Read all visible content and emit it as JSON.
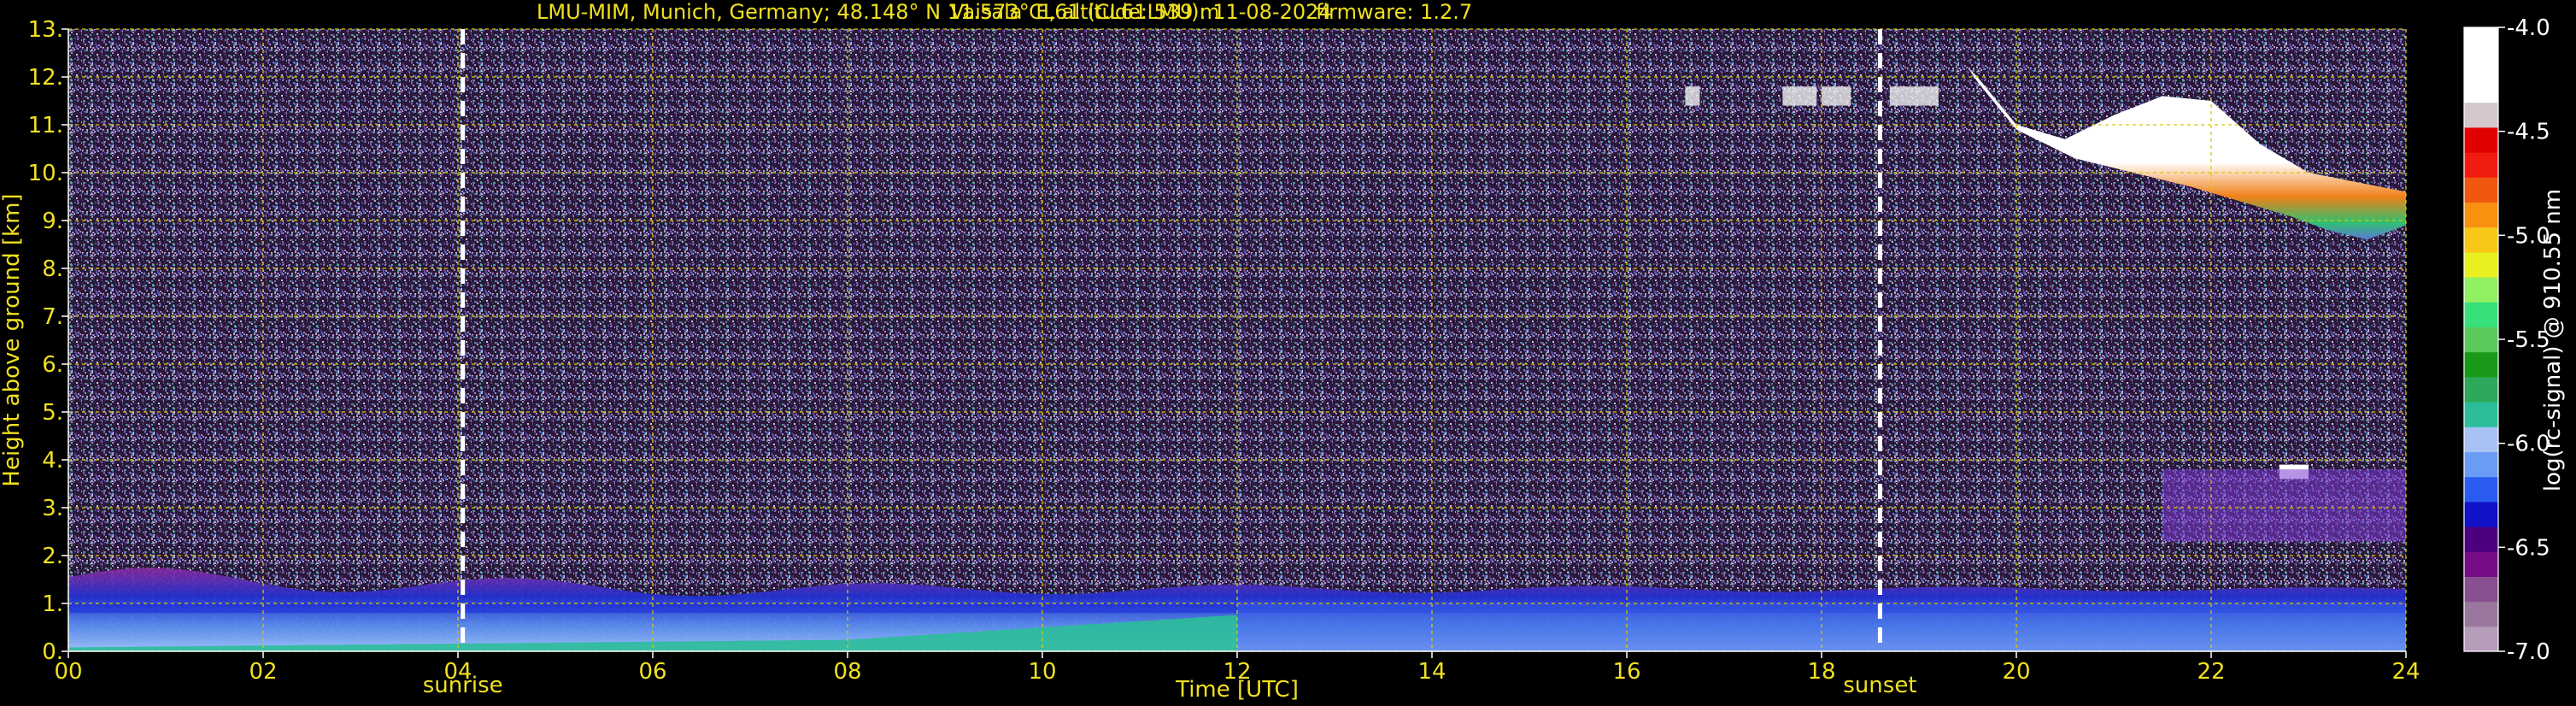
{
  "title_left": "LMU-MIM, Munich, Germany; 48.148° N 11.573° E, altitude: 539 m",
  "title_mid": "Vaisala CL61 (CL61LMU): 11-08-2024",
  "title_right": "firmware: 1.2.7",
  "colors": {
    "text": "#f0e020",
    "background": "#000000",
    "grid": "#d8c800",
    "marker": "#ffffff"
  },
  "chart_data": {
    "type": "heatmap",
    "xlabel": "Time [UTC]",
    "ylabel": "Height above ground [km]",
    "xlim": [
      0,
      24
    ],
    "ylim": [
      0,
      13
    ],
    "x_ticks": [
      {
        "v": 0,
        "label": "00"
      },
      {
        "v": 2,
        "label": "02"
      },
      {
        "v": 4,
        "label": "04"
      },
      {
        "v": 6,
        "label": "06"
      },
      {
        "v": 8,
        "label": "08"
      },
      {
        "v": 10,
        "label": "10"
      },
      {
        "v": 12,
        "label": "12"
      },
      {
        "v": 14,
        "label": "14"
      },
      {
        "v": 16,
        "label": "16"
      },
      {
        "v": 18,
        "label": "18"
      },
      {
        "v": 20,
        "label": "20"
      },
      {
        "v": 22,
        "label": "22"
      },
      {
        "v": 24,
        "label": "24"
      }
    ],
    "y_ticks": [
      {
        "v": 0,
        "label": "0."
      },
      {
        "v": 1,
        "label": "1."
      },
      {
        "v": 2,
        "label": "2."
      },
      {
        "v": 3,
        "label": "3."
      },
      {
        "v": 4,
        "label": "4."
      },
      {
        "v": 5,
        "label": "5."
      },
      {
        "v": 6,
        "label": "6."
      },
      {
        "v": 7,
        "label": "7."
      },
      {
        "v": 8,
        "label": "8."
      },
      {
        "v": 9,
        "label": "9."
      },
      {
        "v": 10,
        "label": "10."
      },
      {
        "v": 11,
        "label": "11."
      },
      {
        "v": 12,
        "label": "12."
      },
      {
        "v": 13,
        "label": "13."
      }
    ],
    "grid": true,
    "markers": [
      {
        "label": "sunrise",
        "time": 4.05
      },
      {
        "label": "sunset",
        "time": 18.6
      }
    ],
    "colorbar": {
      "label": "log(rc-signal) @ 910.55 nm",
      "min": -7.0,
      "max": -4.0,
      "ticks": [
        {
          "v": -4.0,
          "label": "-4.0"
        },
        {
          "v": -4.5,
          "label": "-4.5"
        },
        {
          "v": -5.0,
          "label": "-5.0"
        },
        {
          "v": -5.5,
          "label": "-5.5"
        },
        {
          "v": -6.0,
          "label": "-6.0"
        },
        {
          "v": -6.5,
          "label": "-6.5"
        },
        {
          "v": -7.0,
          "label": "-7.0"
        }
      ],
      "colors": [
        "#b59cb8",
        "#9a789e",
        "#8a4f91",
        "#760d86",
        "#4b0080",
        "#1212c8",
        "#2b5cf0",
        "#6b9cf5",
        "#a8c2f4",
        "#2bbd9a",
        "#2ea85a",
        "#189a18",
        "#5ac85a",
        "#38e07a",
        "#90f060",
        "#e8f020",
        "#f8c818",
        "#f89010",
        "#f05810",
        "#f01c10",
        "#e00000",
        "#d4c8cc",
        "#ffffff",
        "#ffffff",
        "#ffffff"
      ]
    },
    "features": [
      {
        "name": "boundary-layer",
        "t_start": 0,
        "t_end": 24,
        "h_top": 1.3,
        "level": -6.2
      },
      {
        "name": "aerosol-layer",
        "t_start": 0,
        "t_end": 12,
        "h_top": 0.5,
        "level": -5.9
      },
      {
        "name": "cirrus-cloud",
        "t_start": 19.5,
        "t_end": 24,
        "h_base": 8.7,
        "h_top": 12.2,
        "level": -4.2
      },
      {
        "name": "cloud-fragments",
        "t_start": 16.5,
        "t_end": 19.2,
        "h_base": 11.4,
        "h_top": 11.8,
        "level": -5.0
      },
      {
        "name": "low-cloud-fragment",
        "t_start": 22.7,
        "t_end": 23.0,
        "h_base": 3.6,
        "h_top": 3.9,
        "level": -4.3
      }
    ]
  }
}
